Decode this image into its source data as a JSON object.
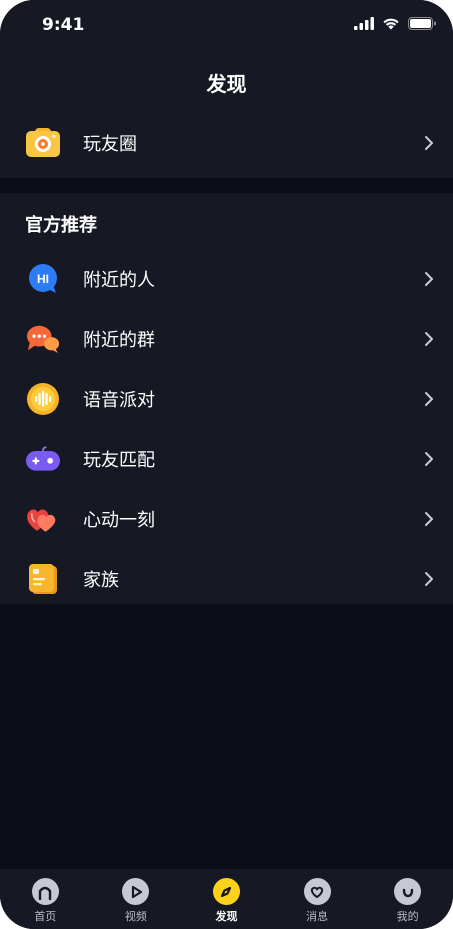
{
  "status_bar": {
    "time": "9:41"
  },
  "header": {
    "title": "发现"
  },
  "top_section": {
    "items": [
      {
        "label": "玩友圈",
        "icon": "camera-icon"
      }
    ]
  },
  "recommend_section": {
    "title": "官方推荐",
    "items": [
      {
        "label": "附近的人",
        "icon": "hi-chat-bubble-icon"
      },
      {
        "label": "附近的群",
        "icon": "group-chat-icon"
      },
      {
        "label": "语音派对",
        "icon": "voice-wave-icon"
      },
      {
        "label": "玩友匹配",
        "icon": "gamepad-icon"
      },
      {
        "label": "心动一刻",
        "icon": "hearts-icon"
      },
      {
        "label": "家族",
        "icon": "family-book-icon"
      }
    ]
  },
  "tab_bar": {
    "active_index": 2,
    "tabs": [
      {
        "label": "首页",
        "icon": "home-icon"
      },
      {
        "label": "视频",
        "icon": "play-icon"
      },
      {
        "label": "发现",
        "icon": "compass-icon"
      },
      {
        "label": "消息",
        "icon": "heart-message-icon"
      },
      {
        "label": "我的",
        "icon": "smile-profile-icon"
      }
    ]
  },
  "colors": {
    "background": "#0b0e17",
    "card": "#161924",
    "accent": "#ffd21a"
  }
}
